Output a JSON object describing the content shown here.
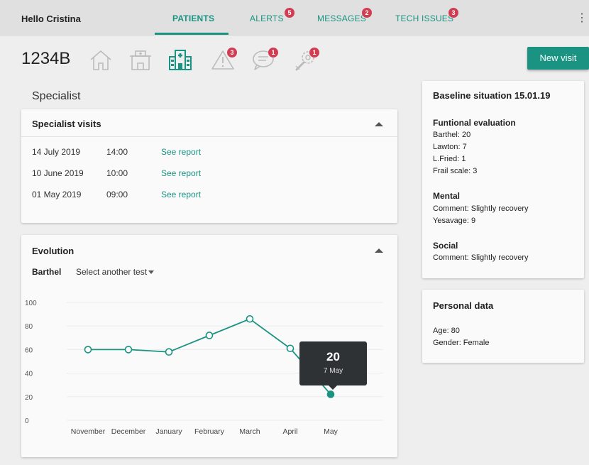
{
  "topbar": {
    "greeting": "Hello Cristina",
    "tabs": [
      {
        "label": "PATIENTS",
        "badge": ""
      },
      {
        "label": "ALERTS",
        "badge": "5"
      },
      {
        "label": "MESSAGES",
        "badge": "2"
      },
      {
        "label": "TECH ISSUES",
        "badge": "3"
      }
    ],
    "more_icon": "vertical-dots-icon"
  },
  "header": {
    "patient_id": "1234B",
    "icons": [
      {
        "name": "home-icon",
        "badge": ""
      },
      {
        "name": "care-home-icon",
        "badge": ""
      },
      {
        "name": "hospital-icon",
        "badge": ""
      },
      {
        "name": "alert-triangle-icon",
        "badge": "3"
      },
      {
        "name": "message-bubble-icon",
        "badge": "1"
      },
      {
        "name": "wrench-gear-icon",
        "badge": "1"
      }
    ],
    "new_visit_label": "New visit"
  },
  "section_title": "Specialist",
  "visits": {
    "title": "Specialist visits",
    "rows": [
      {
        "date": "14 July 2019",
        "time": "14:00",
        "link": "See report"
      },
      {
        "date": "10 June 2019",
        "time": "10:00",
        "link": "See report"
      },
      {
        "date": "01 May 2019",
        "time": "09:00",
        "link": "See report"
      }
    ]
  },
  "evolution": {
    "title": "Evolution",
    "test_label": "Barthel",
    "select_label": "Select another test",
    "tooltip": {
      "value": "20",
      "date": "7 May"
    }
  },
  "chart_data": {
    "type": "line",
    "categories": [
      "November",
      "December",
      "January",
      "February",
      "March",
      "April",
      "May"
    ],
    "values": [
      60,
      60,
      58,
      72,
      86,
      61,
      22
    ],
    "ylim": [
      0,
      100
    ],
    "yticks": [
      0,
      20,
      40,
      60,
      80,
      100
    ],
    "grid": true,
    "title": "",
    "xlabel": "",
    "ylabel": "",
    "highlight_index": 6,
    "line_color": "#1a9382"
  },
  "baseline": {
    "title": "Baseline situation 15.01.19",
    "functional": {
      "heading": "Funtional evaluation",
      "lines": [
        "Barthel: 20",
        "Lawton: 7",
        "L.Fried: 1",
        "Frail scale: 3"
      ]
    },
    "mental": {
      "heading": "Mental",
      "lines": [
        "Comment: Slightly recovery",
        "Yesavage: 9"
      ]
    },
    "social": {
      "heading": "Social",
      "lines": [
        "Comment: Slightly recovery"
      ]
    }
  },
  "personal": {
    "title": "Personal data",
    "lines": [
      "Age: 80",
      "Gender: Female"
    ]
  },
  "colors": {
    "accent": "#1a9382",
    "badge": "#d23c52",
    "tooltip_bg": "#2e3235"
  }
}
